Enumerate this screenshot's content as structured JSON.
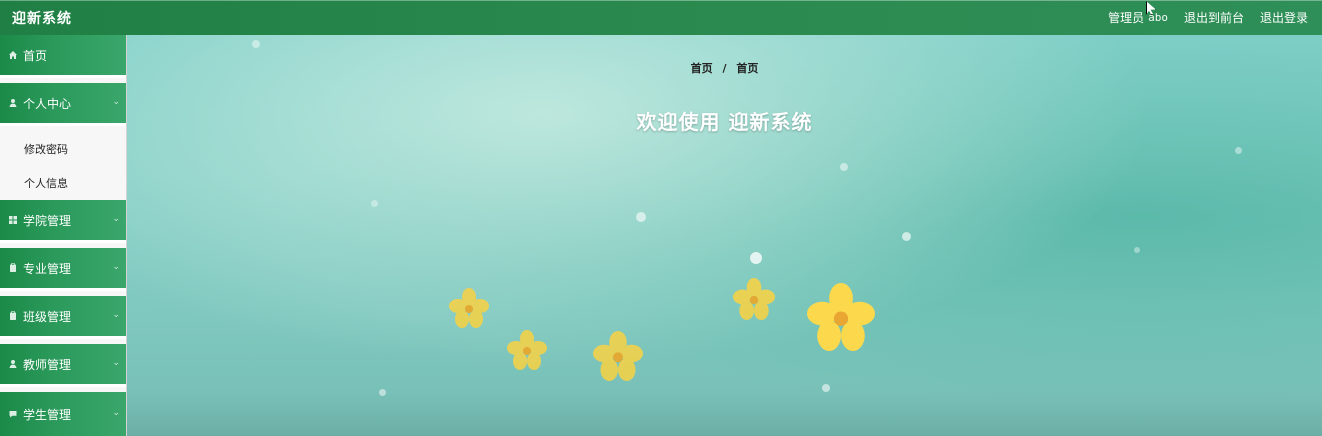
{
  "header": {
    "app_title": "迎新系统",
    "user_role": "管理员",
    "user_name": "abo",
    "link_front": "退出到前台",
    "link_logout": "退出登录"
  },
  "sidebar": {
    "items": [
      {
        "label": "首页",
        "icon": "home-icon"
      },
      {
        "label": "个人中心",
        "icon": "user-icon"
      },
      {
        "label": "学院管理",
        "icon": "grid-icon"
      },
      {
        "label": "专业管理",
        "icon": "clipboard-icon"
      },
      {
        "label": "班级管理",
        "icon": "clipboard-icon"
      },
      {
        "label": "教师管理",
        "icon": "user-icon"
      },
      {
        "label": "学生管理",
        "icon": "chat-icon"
      }
    ],
    "submenu": {
      "items": [
        {
          "label": "修改密码"
        },
        {
          "label": "个人信息"
        }
      ]
    }
  },
  "main": {
    "breadcrumb": [
      "首页",
      "首页"
    ],
    "breadcrumb_sep": "/",
    "welcome_text": "欢迎使用  迎新系统"
  },
  "theme": {
    "topbar": "#2b8a4f",
    "sidebar_item": "#2b9a5b",
    "main_bg": "#84cfc6"
  }
}
